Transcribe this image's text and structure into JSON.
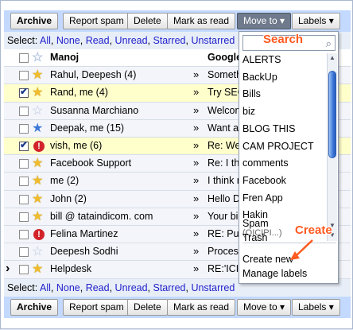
{
  "toolbar": {
    "archive": "Archive",
    "report_spam": "Report spam",
    "delete": "Delete",
    "mark_as_read": "Mark as read",
    "move_to": "Move to ▾",
    "labels": "Labels ▾"
  },
  "select_row": {
    "prefix": "Select: ",
    "links": [
      "All",
      "None",
      "Read",
      "Unread",
      "Starred",
      "Unstarred"
    ],
    "separator": ", "
  },
  "messages": [
    {
      "sender": "Manoj",
      "subject": "Google",
      "star": "empty",
      "checked": false,
      "important": false,
      "unread": true,
      "arrow": ""
    },
    {
      "sender": "Rahul, Deepesh (4)",
      "subject": "Somethi",
      "star": "yellow",
      "checked": false,
      "important": false,
      "unread": false,
      "arrow": "»"
    },
    {
      "sender": "Rand, me (4)",
      "subject": "Try SEO",
      "star": "yellow",
      "checked": true,
      "important": false,
      "unread": false,
      "arrow": "»"
    },
    {
      "sender": "Susanna Marchiano",
      "subject": "Welcome",
      "star": "empty",
      "checked": false,
      "important": false,
      "unread": false,
      "arrow": "»"
    },
    {
      "sender": "Deepak, me (15)",
      "subject": "Want a",
      "star": "blue",
      "checked": false,
      "important": false,
      "unread": false,
      "arrow": "»"
    },
    {
      "sender": "vish, me (6)",
      "subject": "Re: We",
      "star": "important",
      "checked": true,
      "important": true,
      "unread": false,
      "arrow": "»"
    },
    {
      "sender": "Facebook Support",
      "subject": "Re: I th",
      "star": "yellow",
      "checked": false,
      "important": false,
      "unread": false,
      "arrow": "»"
    },
    {
      "sender": "me (2)",
      "subject": "I think r",
      "star": "yellow",
      "checked": false,
      "important": false,
      "unread": false,
      "arrow": "»"
    },
    {
      "sender": "John (2)",
      "subject": "Hello D",
      "star": "yellow",
      "checked": false,
      "important": false,
      "unread": false,
      "arrow": "»"
    },
    {
      "sender": "bill @ tataindicom. com",
      "subject": "Your bil",
      "star": "yellow",
      "checked": false,
      "important": false,
      "unread": false,
      "arrow": "»"
    },
    {
      "sender": "Felina Martinez",
      "subject": "RE: Pu",
      "star": "important",
      "checked": false,
      "important": true,
      "unread": false,
      "arrow": "»"
    },
    {
      "sender": "Deepesh Sodhi",
      "subject": "Process",
      "star": "empty",
      "checked": false,
      "important": false,
      "unread": false,
      "arrow": "»"
    },
    {
      "sender": "Helpdesk",
      "subject": "RE:'ICI",
      "star": "yellow",
      "checked": false,
      "important": false,
      "unread": false,
      "arrow": "»"
    }
  ],
  "menu": {
    "search_value": "",
    "labels": [
      "ALERTS",
      "BackUp",
      "Bills",
      "biz",
      "BLOG THIS",
      "CAM PROJECT",
      "comments",
      "Facebook",
      "Fren App",
      "Hakin"
    ],
    "cut_label": "(OICIPI...)",
    "system": [
      "Spam",
      "Trash"
    ],
    "actions": [
      "Create new",
      "Manage labels"
    ]
  },
  "annotations": {
    "search": "Search",
    "create": "Create"
  },
  "colors": {
    "toolbar_bg": "#c3d9ff",
    "link": "#2222cc",
    "annotation": "#ff5a1f",
    "checked_row": "#ffffcc"
  }
}
